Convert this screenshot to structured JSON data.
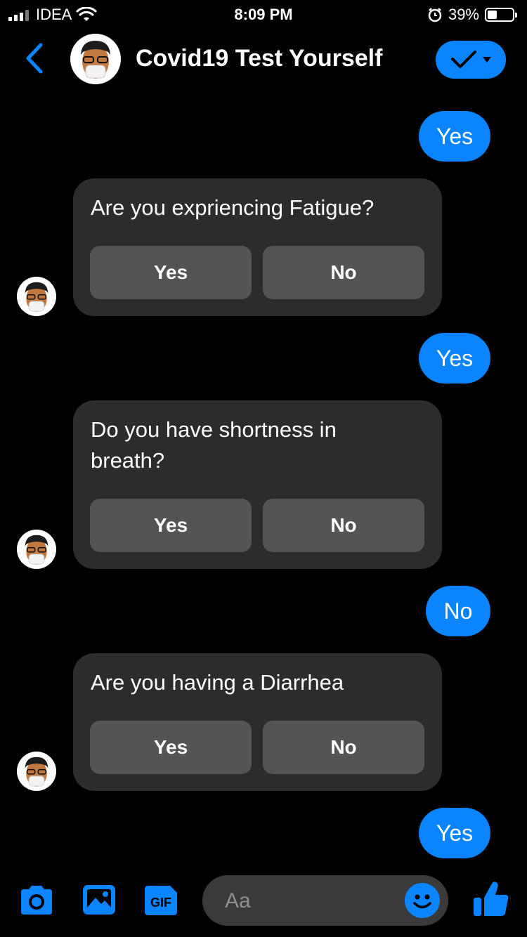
{
  "status_bar": {
    "carrier": "IDEA",
    "time": "8:09 PM",
    "battery": "39%"
  },
  "header": {
    "title": "Covid19 Test Yourself",
    "back_icon": "chevron-left-icon",
    "status_icon": "check-dropdown-icon"
  },
  "messages": [
    {
      "type": "out",
      "text": "Yes"
    },
    {
      "type": "card",
      "question": "Are you expriencing Fatigue?",
      "yes": "Yes",
      "no": "No"
    },
    {
      "type": "out",
      "text": "Yes"
    },
    {
      "type": "card",
      "question": "Do you have shortness in breath?",
      "yes": "Yes",
      "no": "No"
    },
    {
      "type": "out",
      "text": "No"
    },
    {
      "type": "card",
      "question": "Are you having a Diarrhea",
      "yes": "Yes",
      "no": "No"
    },
    {
      "type": "out",
      "text": "Yes"
    }
  ],
  "composer": {
    "placeholder": "Aa",
    "gif_label": "GIF",
    "icons": [
      "camera-icon",
      "photo-icon",
      "gif-icon",
      "emoji-icon",
      "thumbs-up-icon"
    ]
  },
  "colors": {
    "accent": "#0a84ff",
    "bubble_incoming": "#2c2c2e",
    "button": "#545456"
  }
}
